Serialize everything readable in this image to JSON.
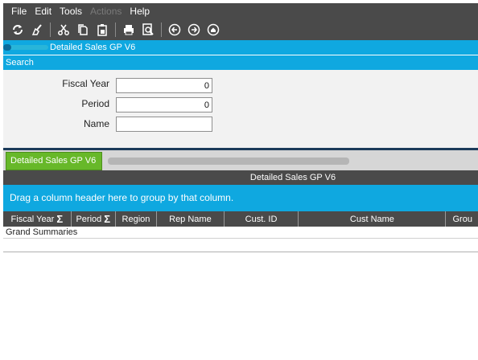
{
  "menubar": {
    "items": [
      {
        "label": "File",
        "enabled": true
      },
      {
        "label": "Edit",
        "enabled": true
      },
      {
        "label": "Tools",
        "enabled": true
      },
      {
        "label": "Actions",
        "enabled": false
      },
      {
        "label": "Help",
        "enabled": true
      }
    ]
  },
  "toolbar": {
    "icons": [
      "refresh-icon",
      "clear-icon",
      "cut-icon",
      "copy-icon",
      "paste-icon",
      "print-icon",
      "print-preview-icon",
      "back-icon",
      "forward-icon",
      "home-icon"
    ]
  },
  "window": {
    "title": "Detailed Sales GP V6"
  },
  "search": {
    "header": "Search",
    "fields": {
      "fiscal_year": {
        "label": "Fiscal Year",
        "value": "0"
      },
      "period": {
        "label": "Period",
        "value": "0"
      },
      "name": {
        "label": "Name",
        "value": ""
      }
    }
  },
  "tabs": [
    {
      "label": "Detailed Sales GP V6",
      "active": true
    }
  ],
  "grid": {
    "title": "Detailed Sales GP V6",
    "group_hint": "Drag a column header here to group by that column.",
    "columns": [
      "Fiscal Year",
      "Period",
      "Region",
      "Rep Name",
      "Cust. ID",
      "Cust Name",
      "Grou"
    ],
    "summary_label": "Grand Summaries"
  },
  "colors": {
    "accent": "#0fa8e0",
    "toolbar": "#4a4a4a",
    "tab_active": "#67b829",
    "panel": "#f2f2f2"
  }
}
